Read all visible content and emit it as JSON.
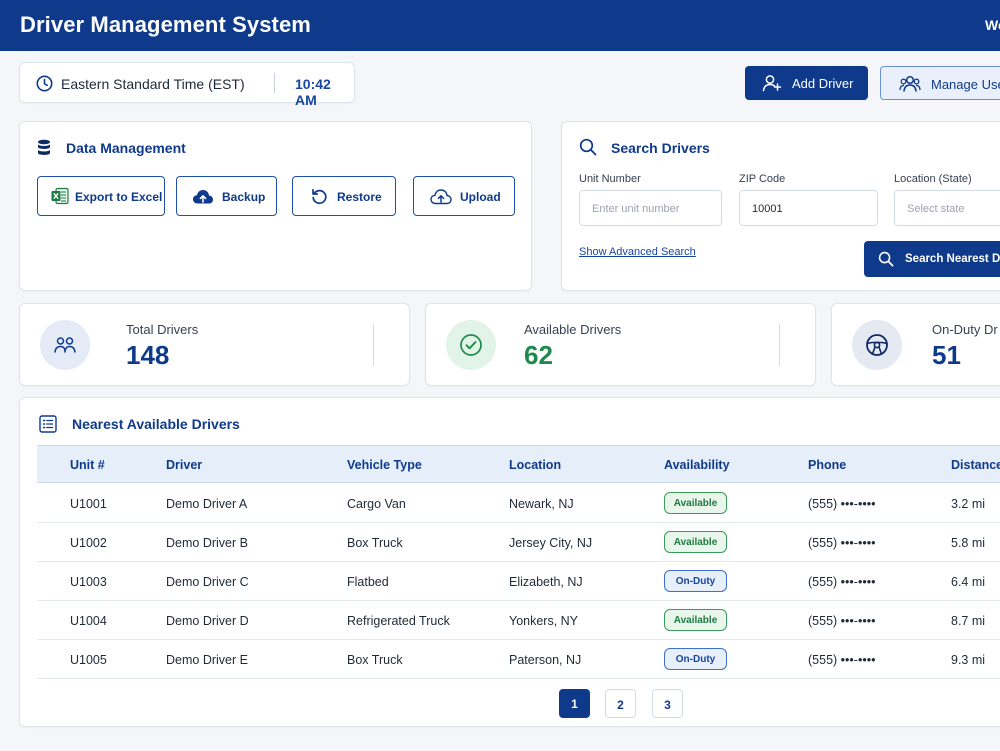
{
  "header": {
    "title": "Driver Management System",
    "welcome": "We"
  },
  "timezone": {
    "label": "Eastern Standard Time (EST)",
    "time": "10:42 AM"
  },
  "actions": {
    "add_driver": "Add Driver",
    "manage_users": "Manage Use"
  },
  "data_management": {
    "title": "Data Management",
    "buttons": [
      "Export to Excel",
      "Backup",
      "Restore",
      "Upload"
    ]
  },
  "search": {
    "title": "Search Drivers",
    "unit_label": "Unit Number",
    "unit_placeholder": "Enter unit number",
    "zip_label": "ZIP Code",
    "zip_value": "10001",
    "state_label": "Location (State)",
    "state_placeholder": "Select state",
    "advanced_link": "Show Advanced Search",
    "submit": "Search Nearest Dr"
  },
  "stats": [
    {
      "label": "Total Drivers",
      "value": "148",
      "color": "#0f3a8c"
    },
    {
      "label": "Available Drivers",
      "value": "62",
      "color": "#1f8a4c"
    },
    {
      "label": "On-Duty Dr",
      "value": "51",
      "color": "#0f3a8c"
    }
  ],
  "table": {
    "title": "Nearest Available Drivers",
    "columns": [
      "Unit #",
      "Driver",
      "Vehicle Type",
      "Location",
      "Availability",
      "Phone",
      "Distance"
    ],
    "rows": [
      {
        "unit": "U1001",
        "driver": "Demo Driver A",
        "vehicle": "Cargo Van",
        "location": "Newark, NJ",
        "availability": "Available",
        "phone": "(555) •••-••••",
        "distance": "3.2 mi"
      },
      {
        "unit": "U1002",
        "driver": "Demo Driver B",
        "vehicle": "Box Truck",
        "location": "Jersey City, NJ",
        "availability": "Available",
        "phone": "(555) •••-••••",
        "distance": "5.8 mi"
      },
      {
        "unit": "U1003",
        "driver": "Demo Driver C",
        "vehicle": "Flatbed",
        "location": "Elizabeth, NJ",
        "availability": "On-Duty",
        "phone": "(555) •••-••••",
        "distance": "6.4 mi"
      },
      {
        "unit": "U1004",
        "driver": "Demo Driver D",
        "vehicle": "Refrigerated Truck",
        "location": "Yonkers, NY",
        "availability": "Available",
        "phone": "(555) •••-••••",
        "distance": "8.7 mi"
      },
      {
        "unit": "U1005",
        "driver": "Demo Driver E",
        "vehicle": "Box Truck",
        "location": "Paterson, NJ",
        "availability": "On-Duty",
        "phone": "(555) •••-••••",
        "distance": "9.3 mi"
      }
    ]
  },
  "pagination": {
    "pages": [
      "1",
      "2",
      "3"
    ],
    "current": "1"
  }
}
